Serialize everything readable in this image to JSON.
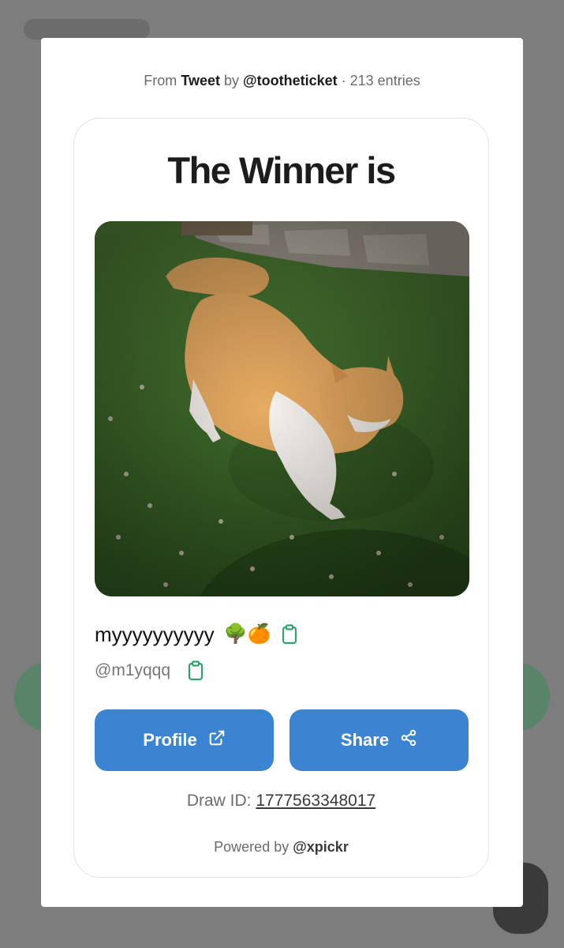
{
  "source": {
    "prefix": "From",
    "platform": "Tweet",
    "by": "by",
    "author": "@tootheticket",
    "separator": "·",
    "entries": "213 entries"
  },
  "card": {
    "title": "The Winner is",
    "winner_name": "myyyyyyyyyy",
    "winner_emojis": "🌳🍊",
    "winner_handle": "@m1yqqq"
  },
  "buttons": {
    "profile_label": "Profile",
    "share_label": "Share"
  },
  "draw": {
    "label": "Draw ID:",
    "id": "1777563348017"
  },
  "footer": {
    "powered_prefix": "Powered by",
    "powered_handle": "@xpickr"
  },
  "colors": {
    "accent": "#3b84d1",
    "copy_icon": "#2fa36b",
    "backdrop": "#7d7d7d"
  },
  "icons": [
    "copy-icon",
    "external-link-icon",
    "share-icon"
  ]
}
